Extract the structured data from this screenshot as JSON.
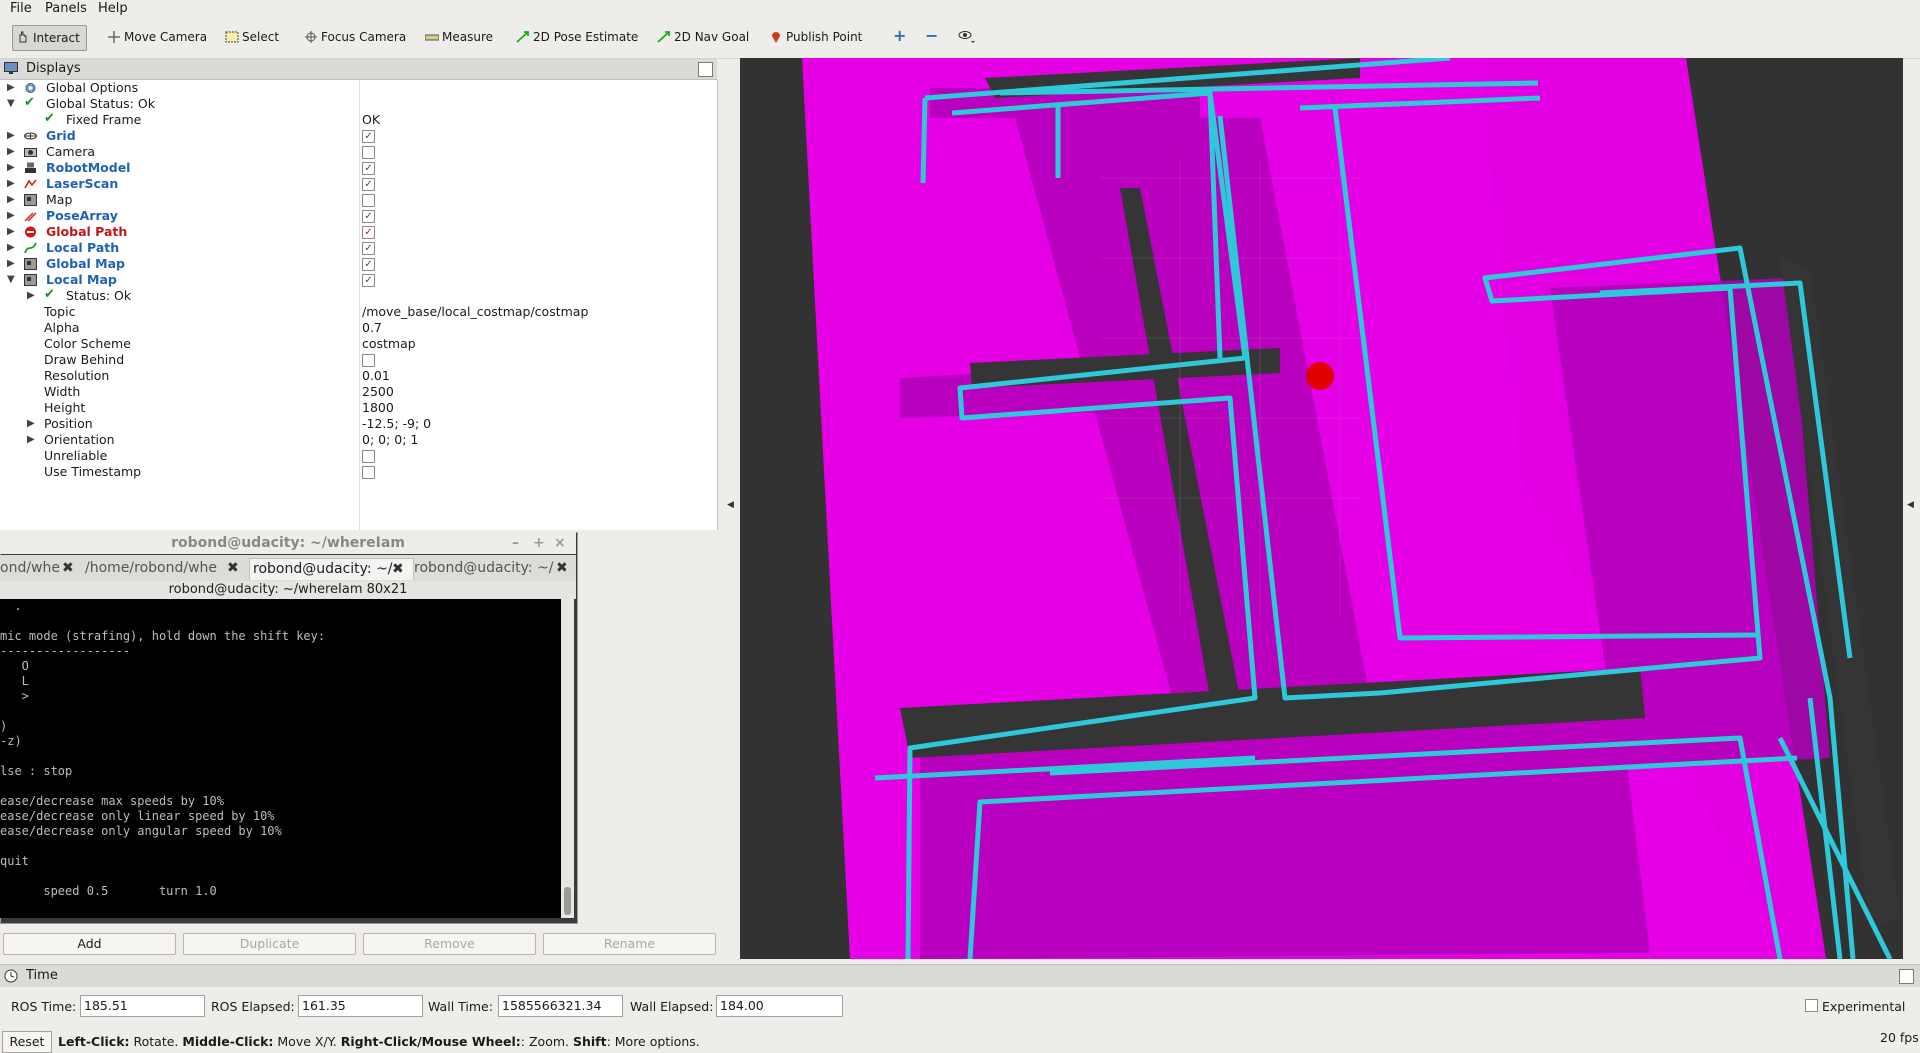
{
  "menu": [
    "File",
    "Panels",
    "Help"
  ],
  "toolbar": {
    "tools": [
      "Interact",
      "Move Camera",
      "Select",
      "Focus Camera",
      "Measure",
      "2D Pose Estimate",
      "2D Nav Goal",
      "Publish Point"
    ]
  },
  "displays": {
    "title": "Displays",
    "rows": {
      "global_options": "Global Options",
      "global_status": "Global Status: Ok",
      "fixed_frame": "Fixed Frame",
      "fixed_frame_val": "OK",
      "grid": "Grid",
      "camera": "Camera",
      "robotmodel": "RobotModel",
      "laserscan": "LaserScan",
      "map": "Map",
      "posearray": "PoseArray",
      "global_path": "Global Path",
      "local_path": "Local Path",
      "global_map": "Global Map",
      "local_map": "Local Map",
      "status": "Status: Ok",
      "topic": "Topic",
      "topic_val": "/move_base/local_costmap/costmap",
      "alpha": "Alpha",
      "alpha_val": "0.7",
      "color_scheme": "Color Scheme",
      "color_scheme_val": "costmap",
      "draw_behind": "Draw Behind",
      "resolution": "Resolution",
      "resolution_val": "0.01",
      "width": "Width",
      "width_val": "2500",
      "height": "Height",
      "height_val": "1800",
      "position": "Position",
      "position_val": "-12.5; -9; 0",
      "orientation": "Orientation",
      "orientation_val": "0; 0; 0; 1",
      "unreliable": "Unreliable",
      "use_timestamp": "Use Timestamp"
    },
    "buttons": [
      "Add",
      "Duplicate",
      "Remove",
      "Rename"
    ]
  },
  "terminal": {
    "title": "robond@udacity: ~/whereIam",
    "tabs": [
      "ond/whe",
      "/home/robond/whe",
      "robond@udacity: ~/",
      "robond@udacity: ~/"
    ],
    "subtitle": "robond@udacity: ~/whereIam 80x21",
    "lines": [
      "  .",
      "",
      "mic mode (strafing), hold down the shift key:",
      "------------------",
      "   O",
      "   L",
      "   >",
      "",
      ")",
      "-z)",
      "",
      "lse : stop",
      "",
      "ease/decrease max speeds by 10%",
      "ease/decrease only linear speed by 10%",
      "ease/decrease only angular speed by 10%",
      "",
      "quit",
      "",
      "      speed 0.5       turn 1.0"
    ]
  },
  "time": {
    "title": "Time",
    "ros_time_label": "ROS Time:",
    "ros_time": "185.51",
    "ros_elapsed_label": "ROS Elapsed:",
    "ros_elapsed": "161.35",
    "wall_time_label": "Wall Time:",
    "wall_time": "1585566321.34",
    "wall_elapsed_label": "Wall Elapsed:",
    "wall_elapsed": "184.00",
    "experimental": "Experimental"
  },
  "status": {
    "reset": "Reset",
    "left_click": "Left-Click:",
    "left_click_desc": " Rotate. ",
    "middle_click": "Middle-Click:",
    "middle_click_desc": " Move X/Y. ",
    "right_click": "Right-Click/Mouse Wheel:",
    "right_click_desc": ": Zoom. ",
    "shift": "Shift",
    "shift_desc": ": More options.",
    "fps": "20 fps"
  },
  "colors": {
    "costmap": "#e600e6",
    "wall": "#2ec8d8",
    "robot": "#e00000",
    "background": "#323232"
  }
}
